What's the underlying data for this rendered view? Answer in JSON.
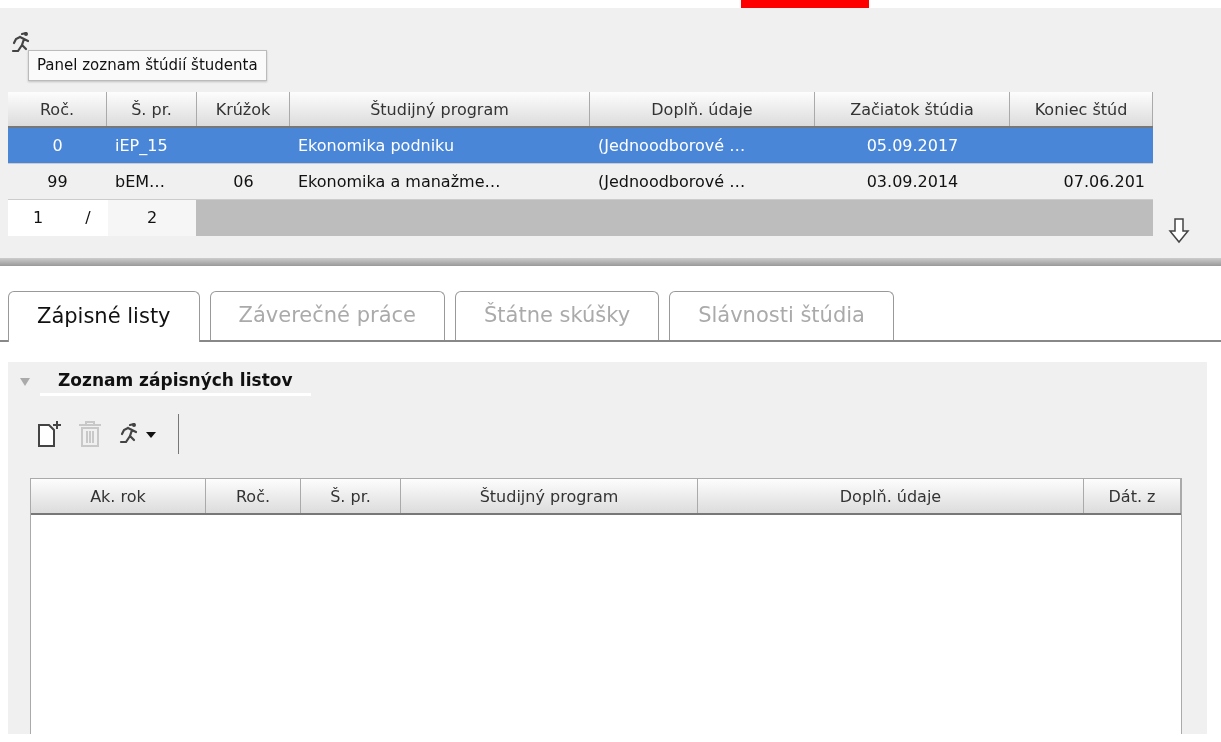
{
  "tooltip": {
    "text": "Panel zoznam štúdií študenta"
  },
  "studies_table": {
    "columns": [
      "Roč.",
      "Š. pr.",
      "Krúžok",
      "Študijný program",
      "Doplň. údaje",
      "Začiatok štúdia",
      "Koniec štúd"
    ],
    "rows": [
      {
        "selected": true,
        "cells": [
          "0",
          "iEP_15",
          "",
          "Ekonomika podniku",
          "(Jednoodborové …",
          "05.09.2017",
          ""
        ]
      },
      {
        "selected": false,
        "cells": [
          "99",
          "bEM…",
          "06",
          "Ekonomika a manažme…",
          "(Jednoodborové …",
          "03.09.2014",
          "07.06.201"
        ]
      }
    ],
    "pager": {
      "current": "1",
      "separator": "/",
      "total": "2"
    }
  },
  "tabs": [
    {
      "label": "Zápisné listy",
      "selected": true,
      "disabled": false
    },
    {
      "label": "Záverečné práce",
      "selected": false,
      "disabled": true
    },
    {
      "label": "Štátne skúšky",
      "selected": false,
      "disabled": true
    },
    {
      "label": "Slávnosti štúdia",
      "selected": false,
      "disabled": true
    }
  ],
  "section": {
    "title": "Zoznam zápisných listov",
    "expanded": true,
    "toolbar": [
      {
        "kind": "new",
        "disabled": false
      },
      {
        "kind": "delete",
        "disabled": true
      },
      {
        "kind": "actions",
        "disabled": false
      }
    ],
    "columns": [
      "Ak. rok",
      "Roč.",
      "Š. pr.",
      "Študijný program",
      "Doplň. údaje",
      "Dát. z"
    ]
  }
}
